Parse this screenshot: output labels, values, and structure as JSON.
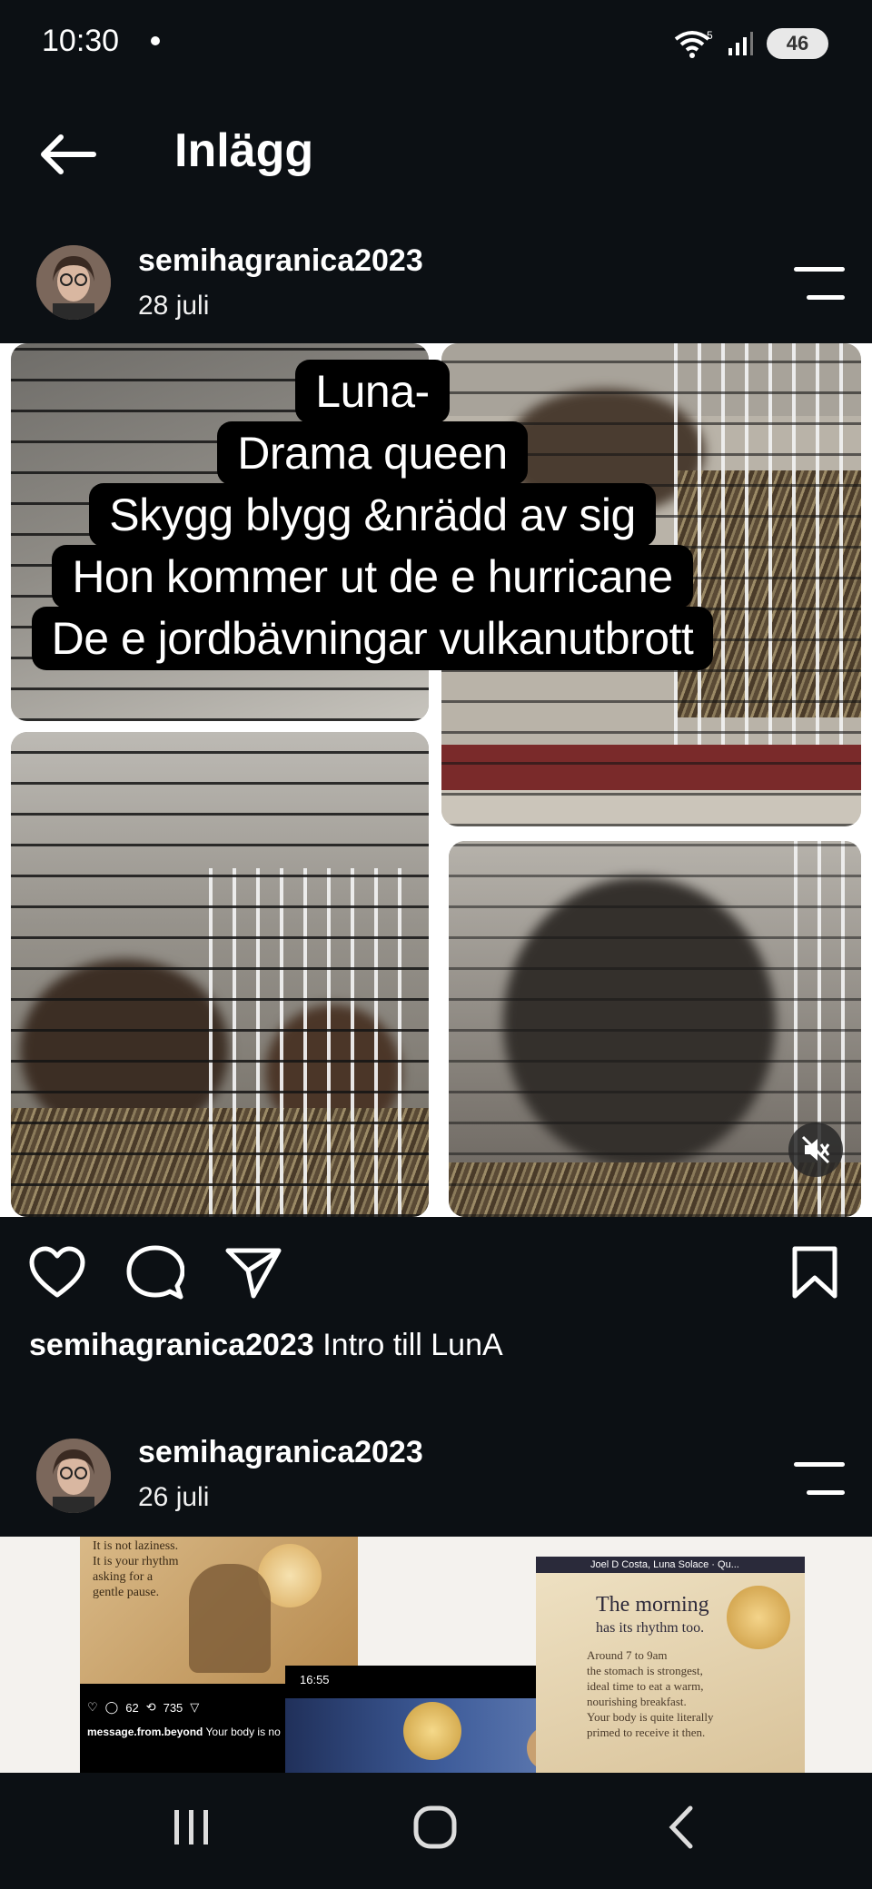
{
  "status_bar": {
    "time": "10:30",
    "battery": "46"
  },
  "header": {
    "title": "Inlägg"
  },
  "post1": {
    "username": "semihagranica2023",
    "date": "28 juli",
    "overlay_lines": [
      "Luna-",
      "Drama queen",
      "Skygg blygg &nrädd av sig",
      "Hon kommer ut de e hurricane",
      "De e jordbävningar vulkanutbrott"
    ],
    "caption_user": "semihagranica2023",
    "caption_text": "Intro till LunA"
  },
  "post2": {
    "username": "semihagranica2023",
    "date": "26 juli",
    "thumb_left_text": "It is not laziness.\nIt is your rhythm\nasking for a\ngentle pause.",
    "thumb_left_likes": "62",
    "thumb_left_shares": "735",
    "thumb_left_caption_user": "message.from.beyond",
    "thumb_left_caption_text": "Your body is no",
    "thumb_mid_time": "16:55",
    "thumb_right_header": "Joel D Costa, Luna Solace · Qu...",
    "thumb_right_title": "The morning",
    "thumb_right_subtitle": "has its rhythm too.",
    "thumb_right_body": "Around 7 to 9am\nthe stomach is strongest,\nideal time to eat a warm,\nnourishing breakfast.\nYour body is quite literally\nprimed to receive it then."
  },
  "colors": {
    "background": "#0c1014",
    "text": "#f5f5f5"
  },
  "icons": [
    "wifi-icon",
    "signal-icon",
    "battery-icon",
    "back-arrow-icon",
    "menu-icon",
    "heart-icon",
    "comment-icon",
    "share-icon",
    "bookmark-icon",
    "mute-icon",
    "recents-icon",
    "home-icon",
    "back-icon"
  ]
}
